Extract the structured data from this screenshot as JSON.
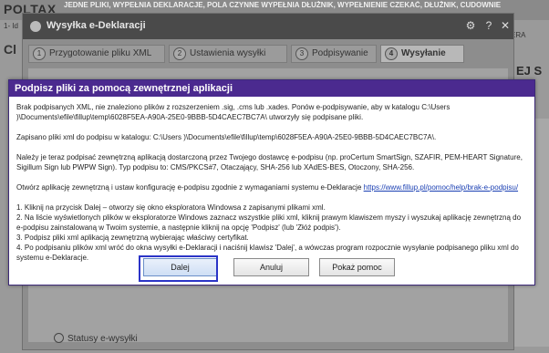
{
  "background": {
    "logo": "POLTAX",
    "banner": "JEDNE PLIKI, WYPEŁNIA DEKLARACJE, POLA CZYNNE WYPEŁNIA DŁUŻNIK, WYPEŁNIENIE CZEKAĆ, DŁUŻNIK, CUDOWNIE",
    "left_small": "1- Id",
    "left_letter": "Cl",
    "right_small": "ERA",
    "right_text": "EJ S"
  },
  "window": {
    "title": "Wysyłka e-Deklaracji",
    "steps": [
      {
        "num": "1",
        "label": "Przygotowanie pliku XML"
      },
      {
        "num": "2",
        "label": "Ustawienia wysyłki"
      },
      {
        "num": "3",
        "label": "Podpisywanie"
      },
      {
        "num": "4",
        "label": "Wysyłanie"
      }
    ],
    "status_label": "Statusy e-wysyłki"
  },
  "dialog": {
    "title": "Podpisz pliki za pomocą zewnętrznej aplikacji",
    "para1": "Brak podpisanych XML, nie znaleziono plików z rozszerzeniem .sig, .cms lub .xades. Ponów e-podpisywanie, aby w katalogu C:\\Users          )\\Documents\\efile\\fillup\\temp\\6028F5EA-A90A-25E0-9BBB-5D4CAEC7BC7A\\ utworzyły się podpisane pliki.",
    "para2": "Zapisano pliki xml do podpisu w katalogu: C:\\Users          )\\Documents\\efile\\fillup\\temp\\6028F5EA-A90A-25E0-9BBB-5D4CAEC7BC7A\\.",
    "para3": "Należy je teraz podpisać zewnętrzną aplikacją dostarczoną przez Twojego dostawcę e-podpisu (np. proCertum SmartSign, SZAFIR, PEM-HEART Signature, Sigillum Sign lub PWPW Sign). Typ podpisu to: CMS/PKCS#7, Otaczający, SHA-256 lub XAdES-BES, Otoczony, SHA-256.",
    "para4_text": "Otwórz aplikację zewnętrzną i ustaw konfigurację e-podpisu zgodnie z wymaganiami systemu e-Deklaracje ",
    "para4_link": "https://www.fillup.pl/pomoc/help/brak-e-podpisu/",
    "steps": [
      "1. Kliknij na przycisk Dalej – otworzy się okno eksploratora Windowsa z zapisanymi plikami xml.",
      "2. Na liście wyświetlonych plików w eksploratorze Windows zaznacz wszystkie pliki xml, kliknij prawym klawiszem myszy i wyszukaj aplikację zewnętrzną do e-podpisu zainstalowaną w Twoim systemie, a następnie kliknij na opcję 'Podpisz' (lub 'Złóż podpis').",
      "3. Podpisz pliki xml aplikacją zewnętrzną wybierając właściwy certyfikat.",
      "4. Po podpisaniu plików xml wróć do okna wysyłki e-Deklaracji i naciśnij klawisz 'Dalej', a wówczas program rozpocznie wysyłanie podpisanego pliku xml do systemu  e-Deklaracje."
    ],
    "buttons": {
      "next": "Dalej",
      "cancel": "Anuluj",
      "help": "Pokaż pomoc"
    },
    "accent_color": "#4b2a8f"
  }
}
